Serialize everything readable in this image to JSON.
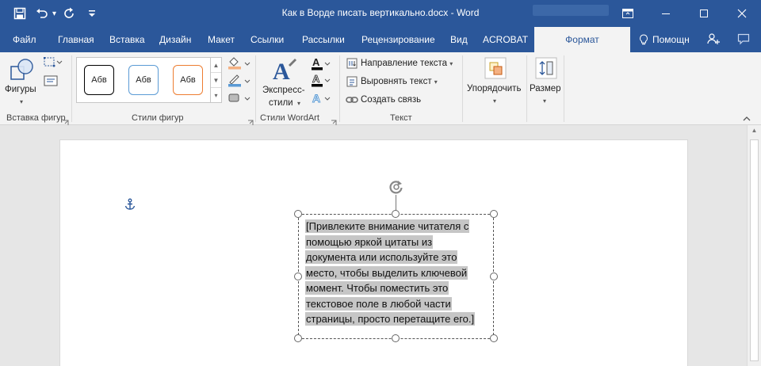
{
  "window": {
    "title": "Как в Ворде писать вертикально.docx - Word"
  },
  "tabs": [
    {
      "label": "Файл"
    },
    {
      "label": "Главная"
    },
    {
      "label": "Вставка"
    },
    {
      "label": "Дизайн"
    },
    {
      "label": "Макет"
    },
    {
      "label": "Ссылки"
    },
    {
      "label": "Рассылки"
    },
    {
      "label": "Рецензирование"
    },
    {
      "label": "Вид"
    },
    {
      "label": "ACROBAT"
    },
    {
      "label": "Формат"
    }
  ],
  "help": {
    "label": "Помощн"
  },
  "ribbon": {
    "insert_shapes": {
      "shapes_label": "Фигуры",
      "group_label": "Вставка фигур"
    },
    "shape_styles": {
      "items": [
        {
          "label": "Абв"
        },
        {
          "label": "Абв"
        },
        {
          "label": "Абв"
        }
      ],
      "group_label": "Стили фигур"
    },
    "wordart": {
      "express_line1": "Экспресс-",
      "express_line2": "стили",
      "group_label": "Стили WordArt"
    },
    "text": {
      "direction_label": "Направление текста",
      "align_label": "Выровнять текст",
      "link_label": "Создать связь",
      "group_label": "Текст"
    },
    "arrange": {
      "label": "Упорядочить"
    },
    "size": {
      "label": "Размер"
    }
  },
  "document": {
    "textbox_lines": [
      "[Привлеките внимание читателя с",
      "помощью яркой цитаты из",
      "документа или используйте это",
      "место, чтобы выделить ключевой",
      "момент. Чтобы поместить это",
      "текстовое поле в любой части",
      "страницы, просто перетащите его.]"
    ]
  },
  "colors": {
    "title_bar": "#2b579a",
    "ribbon_bg": "#f3f3f3",
    "selection_highlight": "#c6c6c6",
    "style_black": "#000000",
    "style_blue": "#5b9bd5",
    "style_orange": "#ed7d31"
  }
}
